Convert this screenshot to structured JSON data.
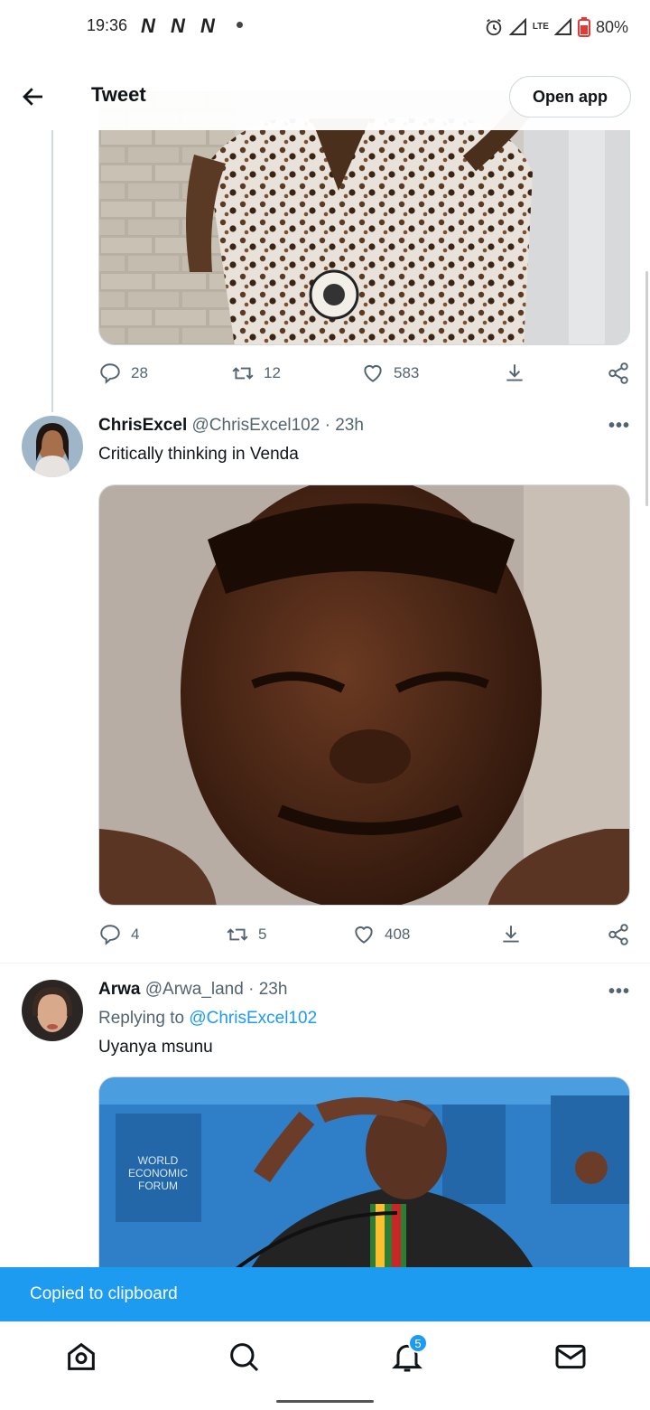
{
  "status_bar": {
    "time": "19:36",
    "carrier_icons": [
      "N",
      "N",
      "N"
    ],
    "lte": "LTE",
    "battery": "80%"
  },
  "header": {
    "title": "Tweet",
    "open_app": "Open app"
  },
  "tweet0": {
    "replies": "28",
    "retweets": "12",
    "likes": "583"
  },
  "tweet1": {
    "name": "ChrisExcel",
    "handle": "@ChrisExcel102",
    "time": "· 23h",
    "text": "Critically thinking in Venda",
    "replies": "4",
    "retweets": "5",
    "likes": "408"
  },
  "tweet2": {
    "name": "Arwa",
    "handle": "@Arwa_land",
    "time": "· 23h",
    "replying_label": "Replying to",
    "replying_handle": "@ChrisExcel102",
    "text": "Uyanya msunu",
    "image_text": [
      "WORLD",
      "ECONOMIC",
      "FORUM"
    ]
  },
  "toast": "Copied to clipboard",
  "nav": {
    "badge": "5"
  },
  "icons": [
    "back-arrow-icon",
    "reply-icon",
    "retweet-icon",
    "like-icon",
    "download-icon",
    "share-icon",
    "more-icon",
    "home-icon",
    "search-icon",
    "bell-icon",
    "mail-icon"
  ],
  "colors": {
    "accent": "#1d9bf0",
    "text": "#0f1419",
    "muted": "#536471"
  }
}
